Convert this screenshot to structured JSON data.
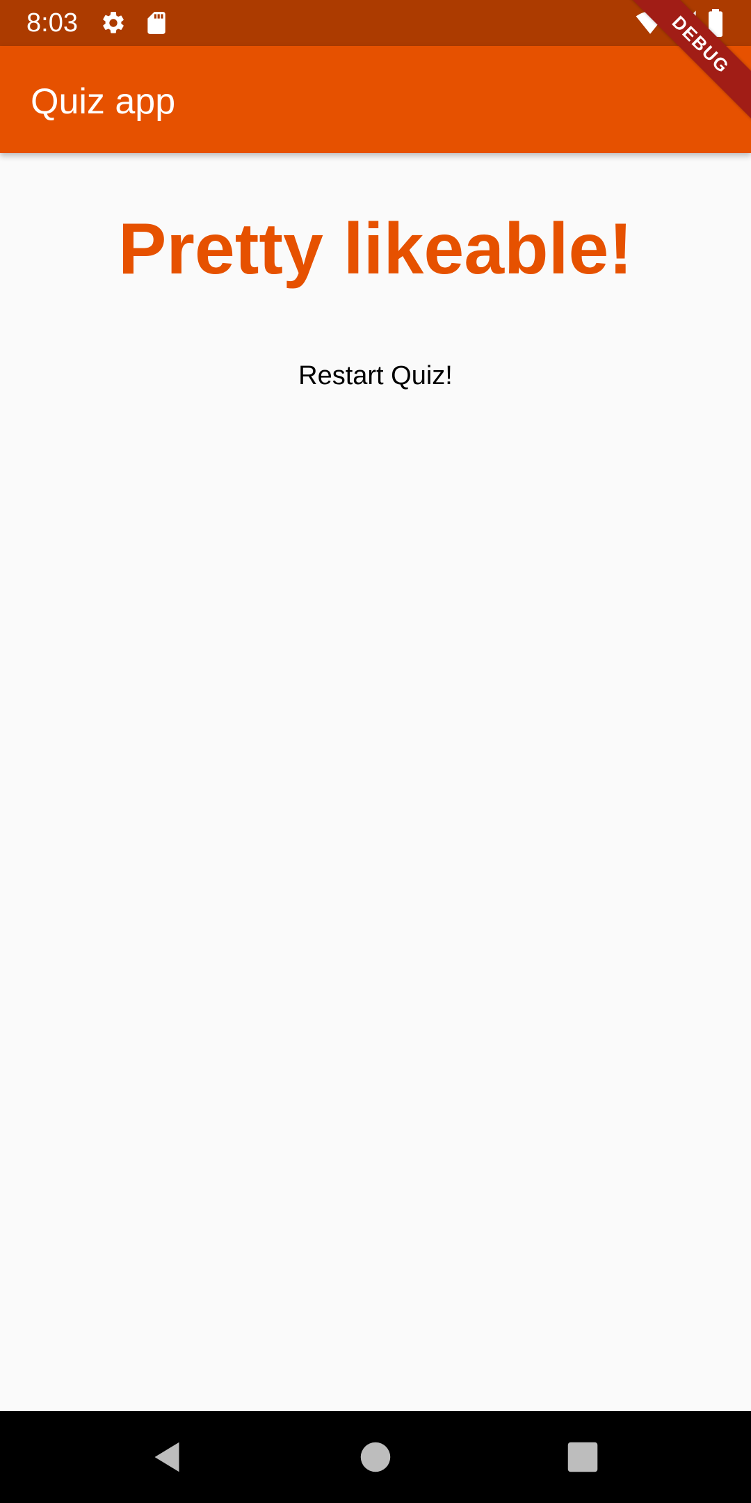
{
  "status_bar": {
    "time": "8:03",
    "background": "#ac3b00",
    "icons_left": [
      "settings-icon",
      "sd-card-icon"
    ],
    "icons_right": [
      "wifi-icon",
      "cell-signal-icon",
      "battery-icon"
    ]
  },
  "debug_banner": {
    "label": "DEBUG",
    "color": "#a11d16"
  },
  "app_bar": {
    "title": "Quiz app",
    "background": "#e65100"
  },
  "result": {
    "text": "Pretty likeable!",
    "color": "#e65100"
  },
  "restart": {
    "label": "Restart Quiz!"
  },
  "nav_bar": {
    "buttons": [
      "back-icon",
      "home-icon",
      "recents-icon"
    ]
  }
}
